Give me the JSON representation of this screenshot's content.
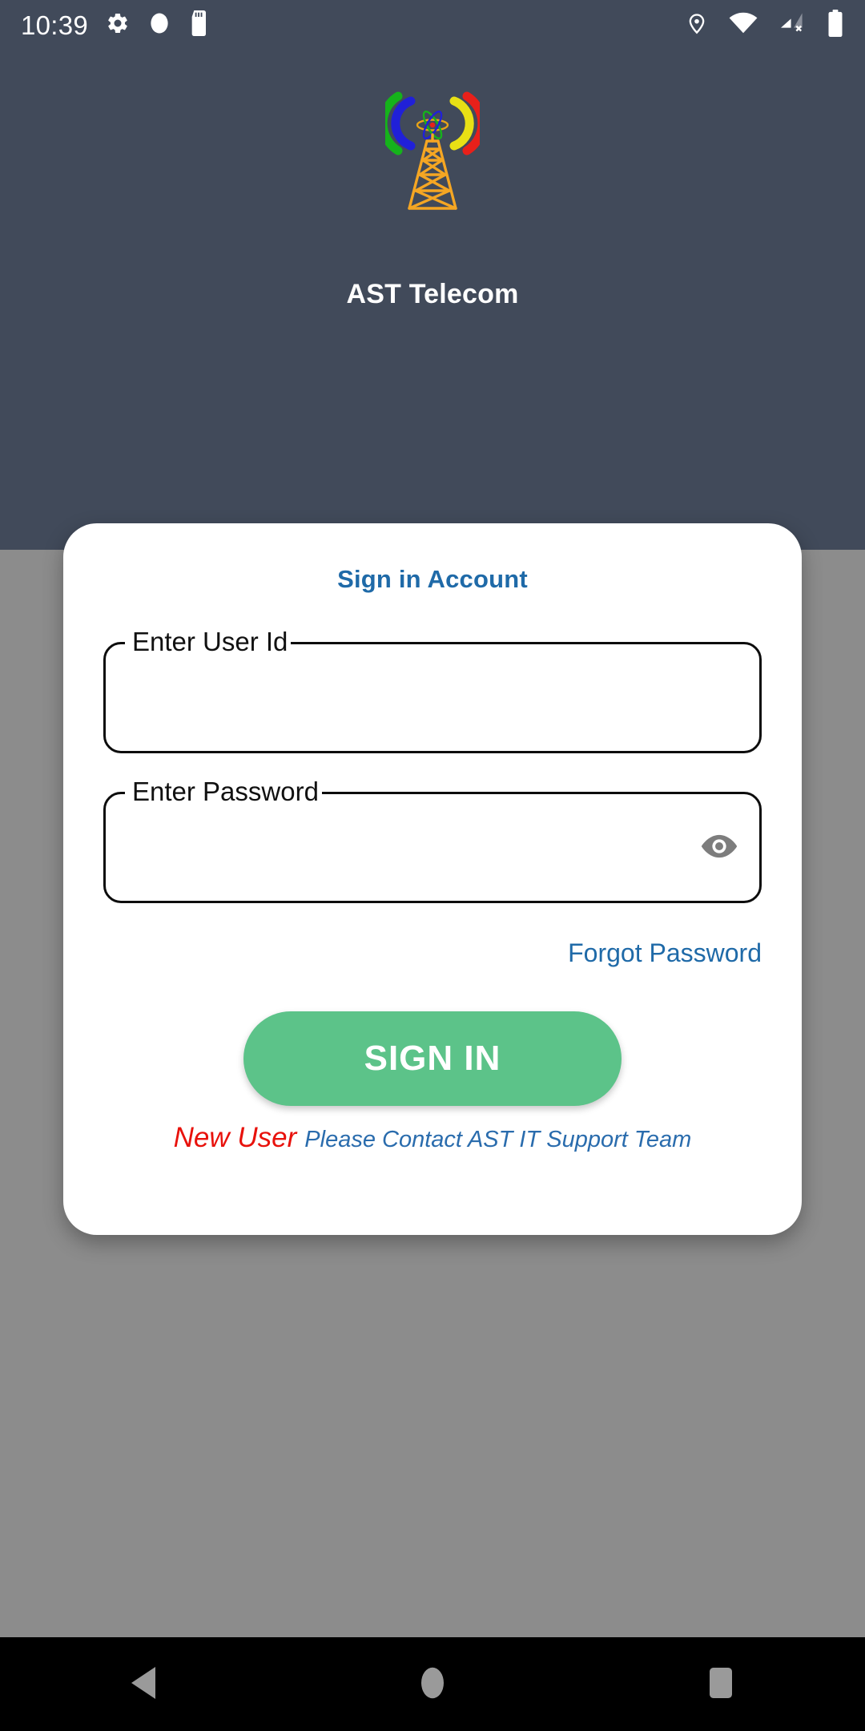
{
  "status_bar": {
    "clock": "10:39",
    "left_icons": [
      "settings-gear-icon",
      "circle-icon",
      "sd-card-icon"
    ],
    "right_icons": [
      "location-pin-icon",
      "wifi-icon",
      "cellular-no-sim-icon",
      "battery-full-icon"
    ]
  },
  "branding": {
    "logo_name": "telecom-tower-logo",
    "app_title": "AST Telecom",
    "logo_colors": {
      "tower": "#F5A623",
      "arc_green": "#15B31B",
      "arc_blue": "#2020D8",
      "arc_yellow": "#E8E015",
      "arc_red": "#E8201A"
    }
  },
  "card": {
    "title": "Sign in Account",
    "user_id": {
      "label": "Enter User Id",
      "value": "",
      "placeholder": ""
    },
    "password": {
      "label": "Enter Password",
      "value": "",
      "placeholder": "",
      "toggle_icon": "eye-visibility-icon"
    },
    "forgot_password": "Forgot Password",
    "signin_button": "SIGN IN",
    "new_user_label": "New User",
    "new_user_hint": "Please Contact AST IT Support Team"
  },
  "nav_bar": {
    "back": "back-triangle-icon",
    "home": "home-circle-icon",
    "recents": "recents-square-icon"
  },
  "colors": {
    "header_bg": "#414a5a",
    "page_bg": "#8c8c8c",
    "card_bg": "#ffffff",
    "accent_blue": "#1f6aa8",
    "button_green": "#5cc389",
    "new_user_red": "#e8120c",
    "nav_bg": "#000000"
  }
}
